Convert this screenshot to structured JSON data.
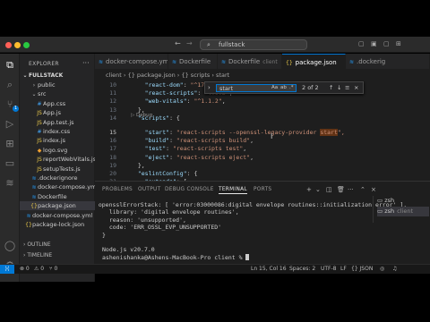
{
  "titlebar": {
    "search": "fullstack"
  },
  "activity": {
    "badge": "1"
  },
  "sidebar": {
    "header": "EXPLORER",
    "root": "FULLSTACK",
    "items": [
      {
        "label": "public",
        "icon": "folder-closed",
        "type": "folder"
      },
      {
        "label": "src",
        "icon": "folder-open",
        "type": "folder"
      },
      {
        "label": "App.css",
        "icon": "css",
        "type": "file"
      },
      {
        "label": "App.js",
        "icon": "js",
        "type": "file"
      },
      {
        "label": "App.test.js",
        "icon": "js",
        "type": "file"
      },
      {
        "label": "index.css",
        "icon": "css",
        "type": "file"
      },
      {
        "label": "index.js",
        "icon": "js",
        "type": "file"
      },
      {
        "label": "logo.svg",
        "icon": "svg",
        "type": "file"
      },
      {
        "label": "reportWebVitals.js",
        "icon": "js",
        "type": "file"
      },
      {
        "label": "setupTests.js",
        "icon": "js",
        "type": "file"
      },
      {
        "label": ".dockerignore",
        "icon": "docker",
        "type": "file"
      },
      {
        "label": "docker-compose.yml",
        "icon": "docker",
        "type": "file"
      },
      {
        "label": "Dockerfile",
        "icon": "docker",
        "type": "file"
      },
      {
        "label": "package.json",
        "icon": "json",
        "type": "file",
        "selected": true
      },
      {
        "label": "docker-compose.yml",
        "icon": "docker",
        "type": "file"
      },
      {
        "label": "package-lock.json",
        "icon": "json",
        "type": "file"
      }
    ],
    "outline": "OUTLINE",
    "timeline": "TIMELINE"
  },
  "tabs": [
    {
      "label": "docker-compose.yml",
      "icon": "docker"
    },
    {
      "label": "Dockerfile",
      "icon": "docker"
    },
    {
      "label": "Dockerfile",
      "sub": "client",
      "icon": "docker"
    },
    {
      "label": "package.json",
      "icon": "json",
      "active": true
    },
    {
      "label": ".dockerig",
      "icon": "docker"
    }
  ],
  "breadcrumb": {
    "parts": [
      "client",
      "{} package.json",
      "{} scripts",
      "start"
    ]
  },
  "editor": {
    "find": {
      "query": "start",
      "count": "2 of 2",
      "opt_case": "Aa",
      "opt_word": "ab",
      "opt_regex": ".*"
    },
    "debug_lens": "▷ Debug",
    "lines": [
      {
        "n": "10",
        "key": "\"react-dom\"",
        "val": "\"^17.0.2\""
      },
      {
        "n": "11",
        "key": "\"react-scripts\"",
        "val": "\"4.0.3\""
      },
      {
        "n": "12",
        "key": "\"web-vitals\"",
        "val": "\"^1.1.2\""
      },
      {
        "n": "13",
        "text": "},"
      },
      {
        "n": "14",
        "key": "\"scripts\"",
        "text_after": ": {"
      },
      {
        "n": "15",
        "key": "\"start\"",
        "val_pre": "\"react-scripts --openssl-legacy-provider ",
        "val_hl": "start",
        "val_post": "\","
      },
      {
        "n": "16",
        "key": "\"build\"",
        "val": "\"react-scripts build\""
      },
      {
        "n": "17",
        "key": "\"test\"",
        "val": "\"react-scripts test\""
      },
      {
        "n": "18",
        "key": "\"eject\"",
        "val": "\"react-scripts eject\""
      },
      {
        "n": "19",
        "text": "},"
      },
      {
        "n": "20",
        "key": "\"eslintConfig\"",
        "text_after": ": {"
      },
      {
        "n": "21",
        "key": "\"extends\"",
        "text_after": ": ["
      }
    ]
  },
  "panel": {
    "tabs": [
      "PROBLEMS",
      "OUTPUT",
      "DEBUG CONSOLE",
      "TERMINAL",
      "PORTS"
    ],
    "active_tab": "TERMINAL",
    "terminal_lines": [
      "  opensslErrorStack: [ 'error:03000086:digital envelope routines::initialization error' ],",
      "  library: 'digital envelope routines',",
      "  reason: 'unsupported',",
      "  code: 'ERR_OSSL_EVP_UNSUPPORTED'",
      "}",
      "",
      "Node.js v20.7.0",
      "ashenishanka@Ashens-MacBook-Pro client % "
    ],
    "terminals": [
      {
        "label": "zsh",
        "sub": ""
      },
      {
        "label": "zsh",
        "sub": "client",
        "active": true
      }
    ]
  },
  "status": {
    "errors": "⊗ 0",
    "warnings": "⚠ 0",
    "ports": "⑂ 0",
    "position": "Ln 15, Col 16",
    "spaces": "Spaces: 2",
    "encoding": "UTF-8",
    "eol": "LF",
    "language": "{} JSON"
  }
}
